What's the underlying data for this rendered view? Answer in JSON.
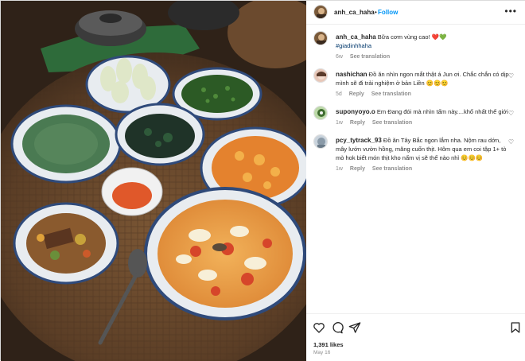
{
  "post": {
    "author": "anh_ca_haha",
    "dot": "•",
    "follow_label": "Follow",
    "more_icon": "more-horizontal-icon"
  },
  "caption": {
    "username": "anh_ca_haha",
    "text": "Bữa cơm vùng cao! ",
    "emoji": "❤️💚",
    "hashtag": "#giadinhhaha",
    "age": "6w",
    "translation": "See translation"
  },
  "comments": [
    {
      "username": "nashichan",
      "text": "Đồ ăn nhìn ngon mắt thật á Jun ơi. Chắc chắn có dịp mình sẽ đi trải nghiệm ở bản Liền 😊😊😊",
      "age": "5d",
      "reply": "Reply",
      "translation": "See translation"
    },
    {
      "username": "suponyoyo.o",
      "text": "Em Đang đói mà nhìn tấm này....khổ nhất thế giới",
      "age": "1w",
      "reply": "Reply",
      "translation": "See translation"
    },
    {
      "username": "pcy_tytrack_93",
      "text": "Đồ ăn Tây Bắc ngon lắm nha. Nộm rau dớn, mây lướn vườn hồng, măng cuốn thịt. Hôm qua em coi tập 1+ tò mò hok biết món thịt kho nấm vị sẽ thế nào nhỉ 😊😊😊",
      "age": "1w",
      "reply": "Reply",
      "translation": "See translation"
    }
  ],
  "footer": {
    "likes": "1,391 likes",
    "date": "May 16"
  },
  "colors": {
    "link_blue": "#0095f6",
    "hashtag": "#00376b",
    "muted": "#8e8e8e"
  }
}
